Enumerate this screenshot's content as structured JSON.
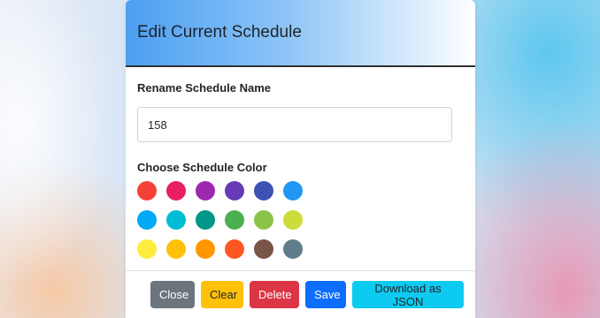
{
  "modal": {
    "title": "Edit Current Schedule",
    "rename_label": "Rename Schedule Name",
    "name_value": "158",
    "color_label": "Choose Schedule Color",
    "colors": [
      "#f44336",
      "#e91e63",
      "#9c27b0",
      "#673ab7",
      "#3f51b5",
      "#2196f3",
      "#03a9f4",
      "#00bcd4",
      "#009688",
      "#4caf50",
      "#8bc34a",
      "#cddc39",
      "#ffeb3b",
      "#ffc107",
      "#ff9800",
      "#ff5722",
      "#795548",
      "#607d8b"
    ]
  },
  "footer": {
    "close_label": "Close",
    "clear_label": "Clear",
    "delete_label": "Delete",
    "save_label": "Save",
    "json_label": "Download as JSON"
  }
}
